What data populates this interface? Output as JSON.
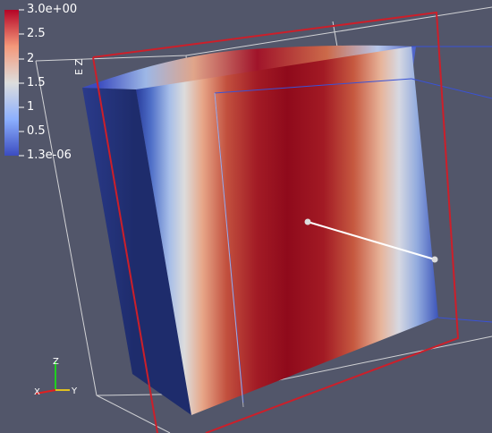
{
  "window": {
    "background": "#52566a"
  },
  "colorbar": {
    "title": "E Z",
    "colormap": "cool-to-warm",
    "colors": {
      "low": "#3b4cc0",
      "mid": "#dddddd",
      "high": "#b40426"
    },
    "labels": {
      "max": "3.0e+00",
      "l25": "2.5",
      "l2": "2",
      "l15": "1.5",
      "l1": "1",
      "l05": "0.5",
      "min": "1.3e-06"
    }
  },
  "scene": {
    "object": "slab",
    "outline_color": "#cc1f2a",
    "bbox_color": "#e8e8e8",
    "edge_color": "#3a52d6",
    "probe_line_color": "#ffffff"
  },
  "orientation_axes": {
    "x_label": "X",
    "y_label": "Y",
    "z_label": "Z",
    "x_color": "#e02020",
    "y_color": "#e0c020",
    "z_color": "#20d020"
  }
}
